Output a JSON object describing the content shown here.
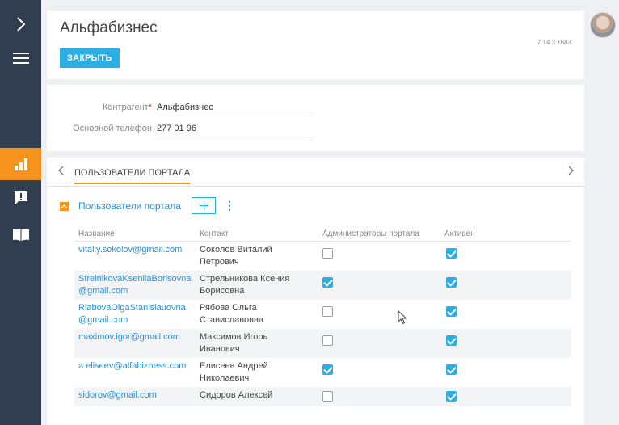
{
  "page": {
    "title": "Альфабизнес",
    "version": "7.14.3.1683",
    "close_label": "ЗАКРЫТЬ"
  },
  "fields": {
    "account_label": "Контрагент",
    "account_value": "Альфабизнес",
    "phone_label": "Основной телефон",
    "phone_value": "277 01 96"
  },
  "tabs": {
    "active_label": "ПОЛЬЗОВАТЕЛИ ПОРТАЛА"
  },
  "detail": {
    "title": "Пользователи портала",
    "columns": [
      "Название",
      "Контакт",
      "Администраторы портала",
      "Активен"
    ],
    "rows": [
      {
        "name": "vitaliy.sokolov@gmail.com",
        "contact": "Соколов Виталий Петрович",
        "admin": false,
        "active": true
      },
      {
        "name": "StrelnikovaKseniiaBorisovna@gmail.com",
        "contact": "Стрельникова Ксения Борисовна",
        "admin": true,
        "active": true
      },
      {
        "name": "RiabovaOlgaStanislauovna@gmail.com",
        "contact": "Рябова Ольга Станиславовна",
        "admin": false,
        "active": true
      },
      {
        "name": "maximov.igor@gmail.com",
        "contact": "Максимов Игорь Иванович",
        "admin": false,
        "active": true
      },
      {
        "name": "a.eliseev@alfabizness.com",
        "contact": "Елисеев Андрей Николаевич",
        "admin": true,
        "active": true
      },
      {
        "name": "sidorov@gmail.com",
        "contact": "Сидоров Алексей",
        "admin": false,
        "active": true
      }
    ]
  },
  "colors": {
    "accent": "#f5931e",
    "primary": "#2aaee3",
    "nav_bg": "#303e50"
  },
  "icons": [
    "chevron-right-icon",
    "hamburger-menu-icon",
    "analytics-icon",
    "feedback-icon",
    "knowledge-base-icon",
    "chevron-left-icon",
    "collapse-icon",
    "plus-icon",
    "kebab-menu-icon",
    "avatar"
  ]
}
